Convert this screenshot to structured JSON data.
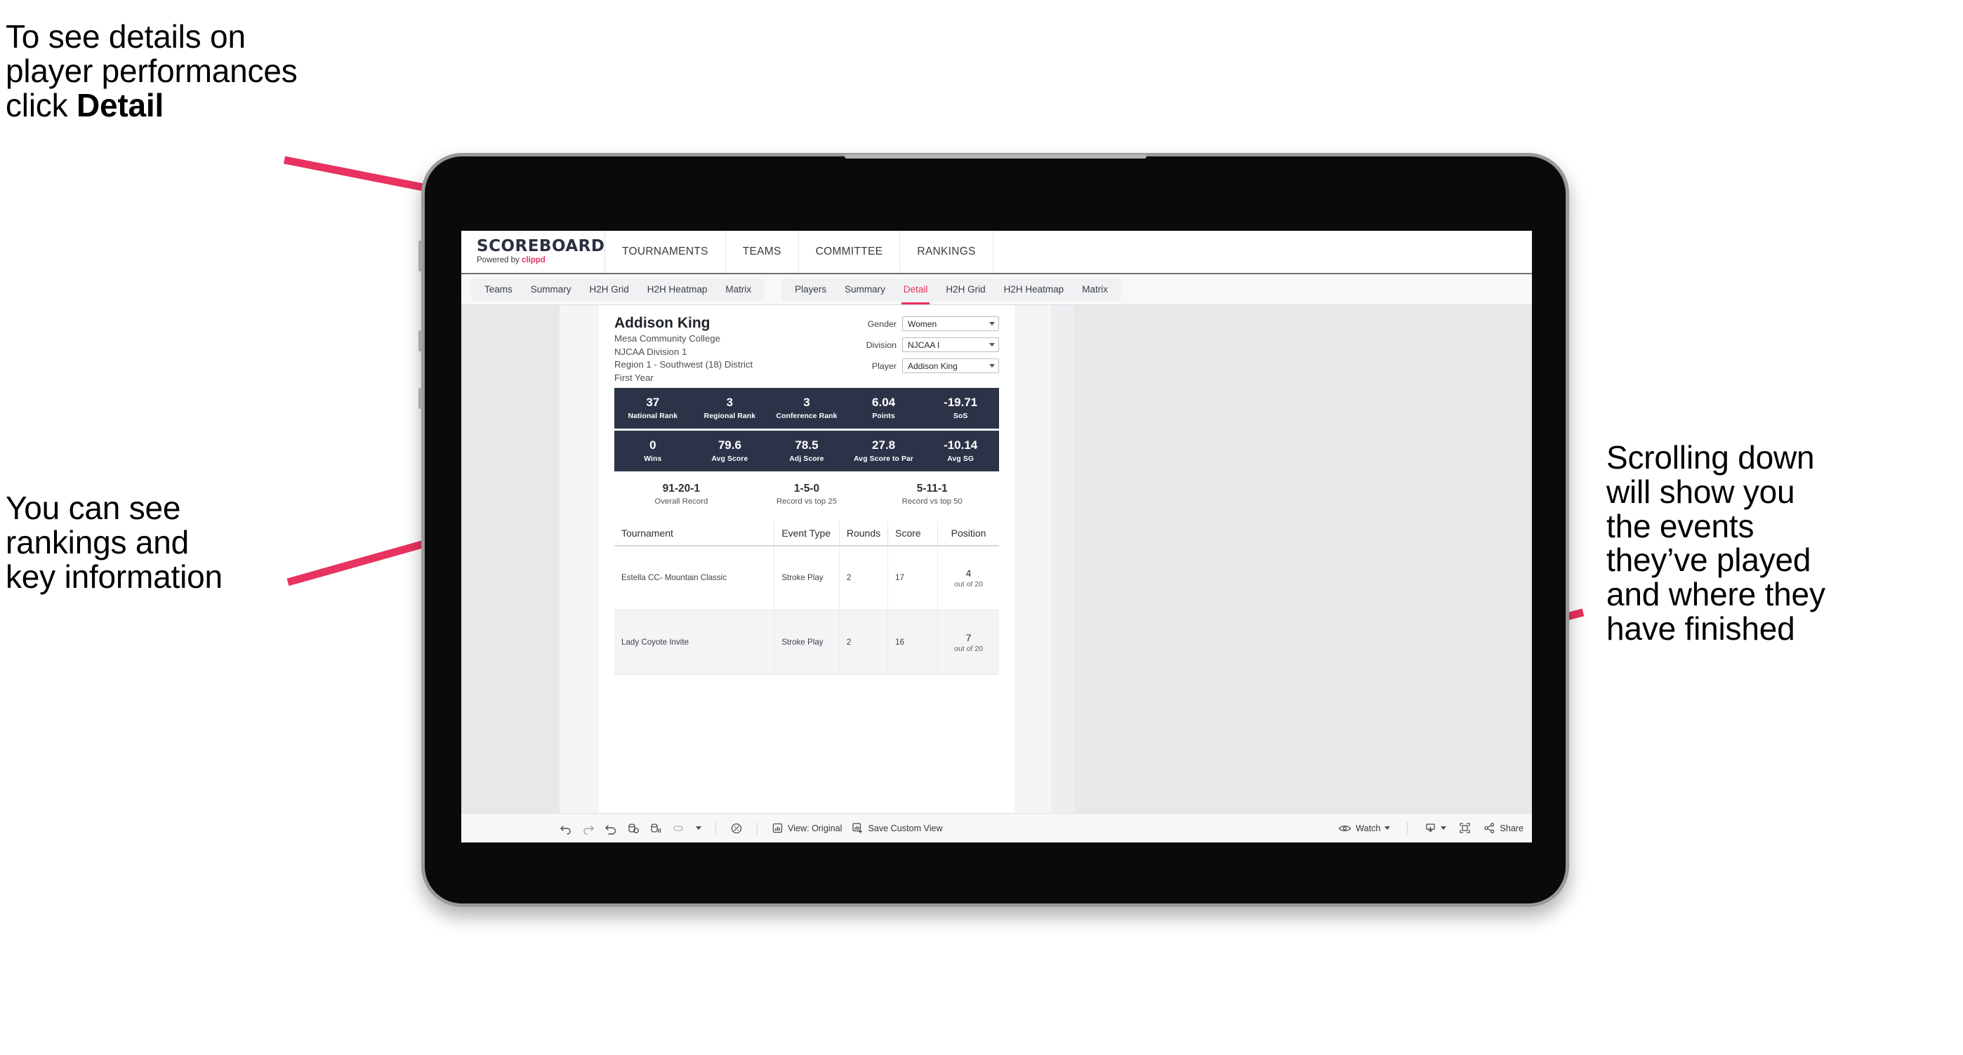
{
  "annotations": {
    "top_left": "To see details on\nplayer performances\nclick ",
    "top_left_bold": "Detail",
    "mid_left": "You can see\nrankings and\nkey information",
    "right": "Scrolling down\nwill show you\nthe events\nthey’ve played\nand where they\nhave finished"
  },
  "colors": {
    "accent_pink": "#e8325f",
    "arrow_pink": "#e8325f",
    "stat_bar_navy": "#2c3348"
  },
  "brand": {
    "logo_main": "SCOREBOARD",
    "logo_sub_prefix": "Powered by ",
    "logo_sub_brand": "clippd"
  },
  "top_nav": {
    "items": [
      {
        "label": "TOURNAMENTS"
      },
      {
        "label": "TEAMS"
      },
      {
        "label": "COMMITTEE"
      },
      {
        "label": "RANKINGS"
      }
    ]
  },
  "sub_nav": {
    "group_teams": [
      {
        "label": "Teams",
        "active": false
      },
      {
        "label": "Summary",
        "active": false
      },
      {
        "label": "H2H Grid",
        "active": false
      },
      {
        "label": "H2H Heatmap",
        "active": false
      },
      {
        "label": "Matrix",
        "active": false
      }
    ],
    "group_players": [
      {
        "label": "Players",
        "active": false
      },
      {
        "label": "Summary",
        "active": false
      },
      {
        "label": "Detail",
        "active": true
      },
      {
        "label": "H2H Grid",
        "active": false
      },
      {
        "label": "H2H Heatmap",
        "active": false
      },
      {
        "label": "Matrix",
        "active": false
      }
    ]
  },
  "player": {
    "name": "Addison King",
    "school": "Mesa Community College",
    "division": "NJCAA Division 1",
    "region": "Region 1 - Southwest (18) District",
    "year": "First Year"
  },
  "filters": [
    {
      "label": "Gender",
      "value": "Women"
    },
    {
      "label": "Division",
      "value": "NJCAA I"
    },
    {
      "label": "Player",
      "value": "Addison King"
    }
  ],
  "stats_row_1": [
    {
      "value": "37",
      "label": "National Rank"
    },
    {
      "value": "3",
      "label": "Regional Rank"
    },
    {
      "value": "3",
      "label": "Conference Rank"
    },
    {
      "value": "6.04",
      "label": "Points"
    },
    {
      "value": "-19.71",
      "label": "SoS"
    }
  ],
  "stats_row_2": [
    {
      "value": "0",
      "label": "Wins"
    },
    {
      "value": "79.6",
      "label": "Avg Score"
    },
    {
      "value": "78.5",
      "label": "Adj Score"
    },
    {
      "value": "27.8",
      "label": "Avg Score to Par"
    },
    {
      "value": "-10.14",
      "label": "Avg SG"
    }
  ],
  "records": [
    {
      "value": "91-20-1",
      "label": "Overall Record"
    },
    {
      "value": "1-5-0",
      "label": "Record vs top 25"
    },
    {
      "value": "5-11-1",
      "label": "Record vs top 50"
    }
  ],
  "events_table": {
    "columns": [
      "Tournament",
      "Event Type",
      "Rounds",
      "Score",
      "Position"
    ],
    "rows": [
      {
        "tournament": "Estella CC- Mountain Classic",
        "event_type": "Stroke Play",
        "rounds": "2",
        "score": "17",
        "position_num": "4",
        "position_of": "out of 20"
      },
      {
        "tournament": "Lady Coyote Invite",
        "event_type": "Stroke Play",
        "rounds": "2",
        "score": "16",
        "position_num": "7",
        "position_of": "out of 20"
      }
    ]
  },
  "toolbar": {
    "view_label": "View: Original",
    "save_label": "Save Custom View",
    "watch_label": "Watch",
    "share_label": "Share"
  }
}
